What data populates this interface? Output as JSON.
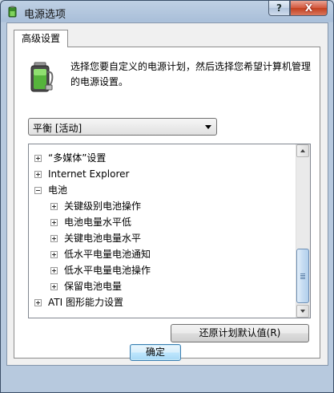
{
  "window": {
    "title": "电源选项",
    "help_label": "?",
    "close_label": "X"
  },
  "tabs": [
    {
      "label": "高级设置",
      "selected": true
    }
  ],
  "description": "选择您要自定义的电源计划，然后选择您希望计算机管理的电源设置。",
  "plan_select": {
    "value": "平衡 [活动]"
  },
  "tree": {
    "nodes": [
      {
        "label": "“多媒体”设置",
        "level": 0,
        "state": "collapsed"
      },
      {
        "label": "Internet Explorer",
        "level": 0,
        "state": "collapsed"
      },
      {
        "label": "电池",
        "level": 0,
        "state": "expanded"
      },
      {
        "label": "关键级别电池操作",
        "level": 1,
        "state": "collapsed"
      },
      {
        "label": "电池电量水平低",
        "level": 1,
        "state": "collapsed"
      },
      {
        "label": "关键电池电量水平",
        "level": 1,
        "state": "collapsed"
      },
      {
        "label": "低水平电量电池通知",
        "level": 1,
        "state": "collapsed"
      },
      {
        "label": "低水平电量电池操作",
        "level": 1,
        "state": "collapsed"
      },
      {
        "label": "保留电池电量",
        "level": 1,
        "state": "collapsed"
      },
      {
        "label": "ATI 图形能力设置",
        "level": 0,
        "state": "collapsed"
      }
    ]
  },
  "buttons": {
    "restore_defaults": "还原计划默认值(R)",
    "ok": "确定"
  },
  "colors": {
    "frame": "#b7c9de",
    "close_button": "#c3401f",
    "scroll_thumb": "#c6dcf2"
  }
}
